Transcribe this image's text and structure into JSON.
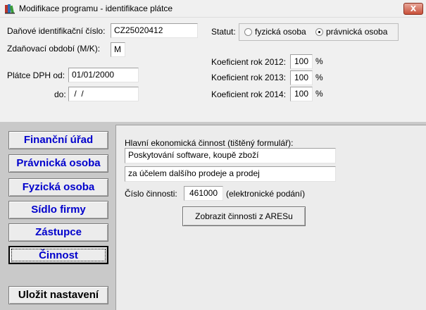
{
  "window": {
    "title": "Modifikace programu - identifikace plátce",
    "close_label": "X"
  },
  "form": {
    "dic_label": "Daňové identifikační číslo:",
    "dic_value": "CZ25020412",
    "period_label": "Zdaňovací období (M/K):",
    "period_value": "M",
    "vat_from_label": "Plátce DPH od:",
    "vat_from_value": "01/01/2000",
    "vat_to_label": "do:",
    "vat_to_value": " /  /",
    "statut_label": "Statut:",
    "statut_options": [
      {
        "label": "fyzická osoba",
        "selected": false
      },
      {
        "label": "právnická osoba",
        "selected": true
      }
    ],
    "coefficients": [
      {
        "label": "Koeficient rok 2012:",
        "value": "100",
        "unit": "%"
      },
      {
        "label": "Koeficient rok 2013:",
        "value": "100",
        "unit": "%"
      },
      {
        "label": "Koeficient rok 2014:",
        "value": "100",
        "unit": "%"
      }
    ]
  },
  "sidebar": {
    "items": [
      {
        "label": "Finanční úřad",
        "active": false
      },
      {
        "label": "Právnická osoba",
        "active": false
      },
      {
        "label": "Fyzická osoba",
        "active": false
      },
      {
        "label": "Sídlo firmy",
        "active": false
      },
      {
        "label": "Zástupce",
        "active": false
      },
      {
        "label": "Činnost",
        "active": true
      }
    ],
    "save_label": "Uložit nastavení"
  },
  "activity": {
    "main_label": "Hlavní ekonomická činnost (tištěný formulář):",
    "line1": "Poskytování software, koupě zboží",
    "line2": "za účelem dalšího prodeje a prodej",
    "number_label": "Číslo činnosti:",
    "number_value": "461000",
    "number_note": "(elektronické podání)",
    "ares_button": "Zobrazit činnosti z ARESu"
  },
  "colors": {
    "nav_text": "#0000cc",
    "panel_bg": "#f0f0f0",
    "lower_bg": "#c9c9c9"
  }
}
